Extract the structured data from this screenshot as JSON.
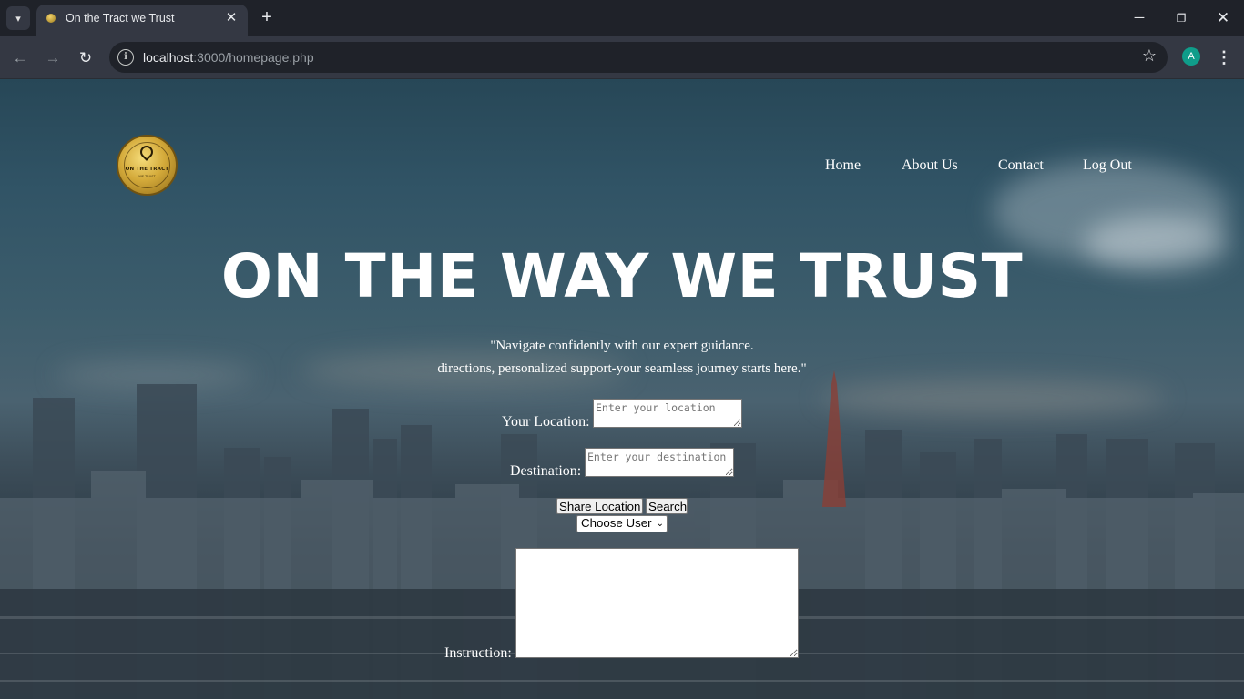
{
  "browser": {
    "tab_title": "On the Tract we Trust",
    "url_host": "localhost",
    "url_path": ":3000/homepage.php",
    "profile_initial": "A",
    "icons": {
      "tab_search": "chevron-down-icon",
      "tab_close": "close-icon",
      "new_tab": "plus-icon",
      "back": "arrow-left-icon",
      "forward": "arrow-right-icon",
      "reload": "reload-icon",
      "site_info": "info-icon",
      "bookmark": "star-icon",
      "menu": "kebab-menu-icon"
    },
    "colors": {
      "frame": "#1f2229",
      "toolbar": "#343843",
      "profile": "#0f9d8a"
    }
  },
  "site": {
    "logo": {
      "title": "ON THE TRACT",
      "subtitle": "WE TRUST"
    },
    "nav": {
      "home": "Home",
      "about": "About Us",
      "contact": "Contact",
      "logout": "Log Out"
    },
    "hero_title": "ON THE WAY WE TRUST",
    "quote_line1": "\"Navigate confidently with our expert guidance.",
    "quote_line2": "directions, personalized support-your seamless journey starts here.\"",
    "form": {
      "location_label": "Your Location:",
      "location_placeholder": "Enter your location",
      "destination_label": "Destination:",
      "destination_placeholder": "Enter your destination",
      "share_button": "Share Location",
      "search_button": "Search",
      "user_select": "Choose User",
      "instruction_label": "Instruction:",
      "instruction_value": ""
    }
  }
}
